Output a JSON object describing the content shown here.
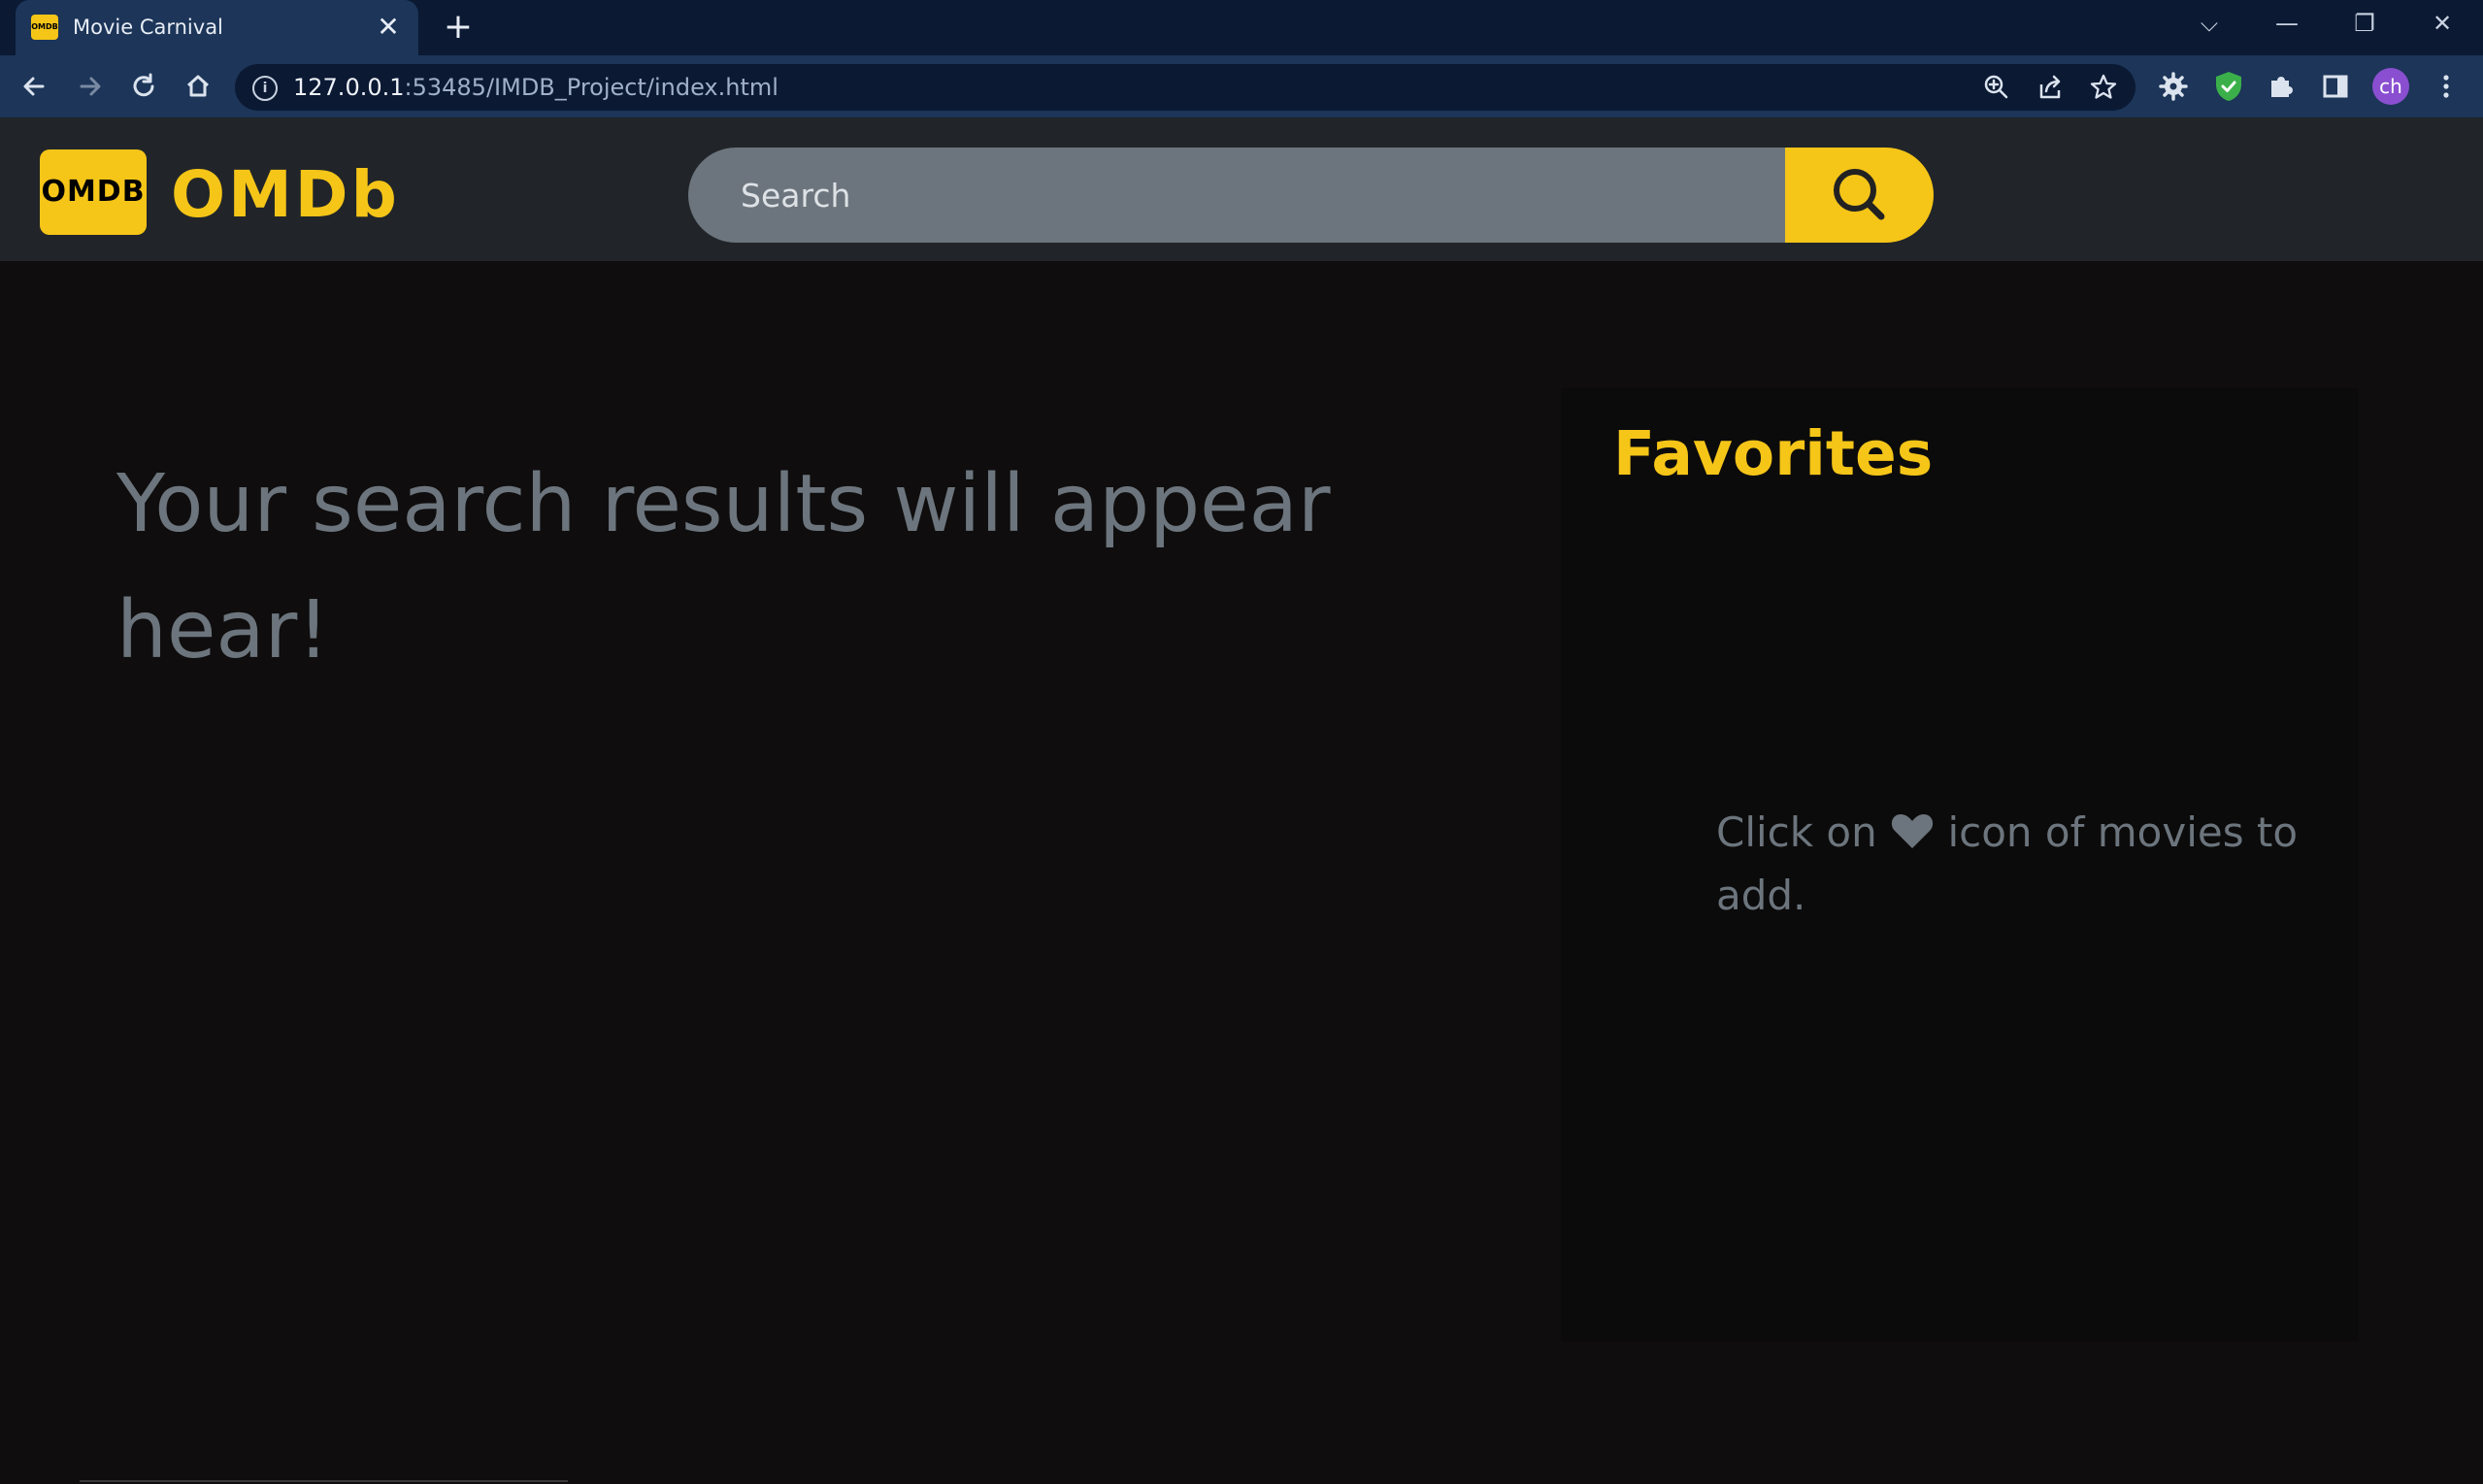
{
  "browser": {
    "tab_title": "Movie Carnival",
    "tab_favicon_text": "OMDB",
    "tab_close": "✕",
    "new_tab": "+",
    "url_host": "127.0.0.1",
    "url_rest": ":53485/IMDB_Project/index.html",
    "profile_initials": "ch",
    "window_controls": {
      "dropdown": "⌵",
      "minimize": "—",
      "restore": "❐",
      "close": "✕"
    },
    "icons": [
      "back-icon",
      "forward-icon",
      "reload-icon",
      "home-icon",
      "site-info-icon",
      "zoom-icon",
      "share-icon",
      "bookmark-star-icon",
      "settings-extension-icon",
      "shield-extension-icon",
      "puzzle-extensions-icon",
      "side-panel-icon",
      "menu-icon"
    ]
  },
  "header": {
    "logo_text": "OMDB",
    "brand": "OMDb",
    "search_placeholder": "Search"
  },
  "main": {
    "results_message": "Your search results will appear hear!"
  },
  "favorites": {
    "title": "Favorites",
    "hint_before": "Click on",
    "hint_after": "icon of movies to add."
  },
  "colors": {
    "accent": "#f5c518",
    "background": "#0f0d0d",
    "header_bg": "#212529",
    "muted_text": "#6c757d",
    "search_bg": "#6c757d"
  }
}
